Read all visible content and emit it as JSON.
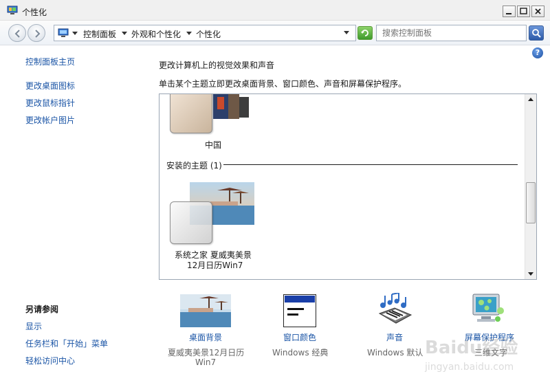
{
  "window": {
    "title": "个性化",
    "minimize_label": "Minimize",
    "maximize_label": "Maximize",
    "close_label": "Close"
  },
  "address": {
    "breadcrumbs": [
      "控制面板",
      "外观和个性化",
      "个性化"
    ],
    "search_placeholder": "搜索控制面板"
  },
  "sidebar": {
    "home_link": "控制面板主页",
    "links": [
      "更改桌面图标",
      "更改鼠标指针",
      "更改帐户图片"
    ],
    "see_also_heading": "另请参阅",
    "see_also_links": [
      "显示",
      "任务栏和「开始」菜单",
      "轻松访问中心"
    ]
  },
  "main": {
    "title": "更改计算机上的视觉效果和声音",
    "description": "单击某个主题立即更改桌面背景、窗口颜色、声音和屏幕保护程序。"
  },
  "themes": {
    "top_theme_label": "中国",
    "installed_group_header": "安装的主题 (1)",
    "installed_theme_label_line1": "系统之家 夏威夷美景",
    "installed_theme_label_line2": "12月日历Win7"
  },
  "settings": [
    {
      "label": "桌面背景",
      "value_line1": "夏威夷美景12月日历",
      "value_line2": "Win7",
      "icon": "desktop-background-icon"
    },
    {
      "label": "窗口颜色",
      "value_line1": "Windows 经典",
      "value_line2": "",
      "icon": "window-color-icon"
    },
    {
      "label": "声音",
      "value_line1": "Windows 默认",
      "value_line2": "",
      "icon": "sound-icon"
    },
    {
      "label": "屏幕保护程序",
      "value_line1": "三维文字",
      "value_line2": "",
      "icon": "screensaver-icon"
    }
  ],
  "watermark": {
    "text1": "Baidu经验",
    "text2": "jingyan.baidu.com"
  },
  "colors": {
    "link": "#1b55a6",
    "text": "#1a1a1a",
    "muted": "#666666",
    "accent_green": "#3e9a2b",
    "accent_blue": "#2c5aa8"
  }
}
